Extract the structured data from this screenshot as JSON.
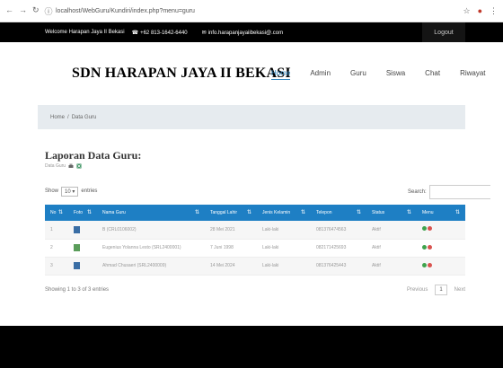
{
  "browser": {
    "url": "localhost/WebGuru/Kundiri/index.php?menu=guru"
  },
  "topbar": {
    "welcome": "Welcome Harapan Jaya II Bekasi",
    "phone": "+62 813-1642-6440",
    "email": "info.harapanjayaiibekasi@.com",
    "logout": "Logout"
  },
  "header": {
    "brand": "SDN HARAPAN JAYA II BEKASI",
    "menu": [
      "Home",
      "Admin",
      "Guru",
      "Siswa",
      "Chat",
      "Riwayat"
    ]
  },
  "breadcrumb": {
    "home": "Home",
    "sep": "/",
    "current": "Data Guru"
  },
  "page": {
    "title": "Laporan Data Guru:",
    "subtitle": "Data Guru"
  },
  "controls": {
    "show": "Show",
    "entries_value": "10",
    "entries": "entries",
    "search": "Search:"
  },
  "table": {
    "columns": [
      "No",
      "Foto",
      "Nama Guru",
      "Tanggal Lahir",
      "Jenis Kelamin",
      "Telepon",
      "Status",
      "Menu"
    ],
    "rows": [
      [
        "1",
        "",
        "B (CRL0106002)",
        "28 Mei 2021",
        "Laki-laki",
        "081376474563",
        "Aktif"
      ],
      [
        "2",
        "",
        "Eugenius Yolanna Lesto (SRL2400001)",
        "7 Juni 1998",
        "Laki-laki",
        "082171425693",
        "Aktif"
      ],
      [
        "3",
        "",
        "Ahmad Chusaeri (SRL2400009)",
        "14 Mei 2024",
        "Laki-laki",
        "081376425443",
        "Aktif"
      ]
    ]
  },
  "footer": {
    "info": "Showing 1 to 3 of 3 entries",
    "previous": "Previous",
    "page": "1",
    "next": "Next"
  },
  "colors": {
    "accent": "#1e7fc4",
    "topbar": "#000000"
  }
}
